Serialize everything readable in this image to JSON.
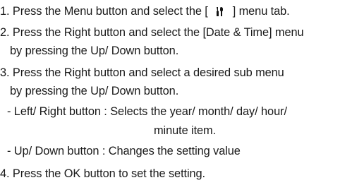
{
  "instructions": {
    "step1": {
      "prefix": "1. Press the Menu button and select the [",
      "icon": "tools-icon",
      "suffix": "] menu tab."
    },
    "step2": {
      "line1": "2. Press the Right button and select the [Date & Time] menu",
      "line2": "by pressing the Up/ Down button."
    },
    "step3": {
      "line1": "3. Press the Right button and select a desired sub menu",
      "line2": "by pressing the Up/ Down button.",
      "bullet1_line1": "- Left/ Right button : Selects the year/ month/ day/ hour/",
      "bullet1_line2": "minute item.",
      "bullet2": "- Up/ Down button : Changes the setting value"
    },
    "step4": "4. Press the OK button to set the setting."
  }
}
